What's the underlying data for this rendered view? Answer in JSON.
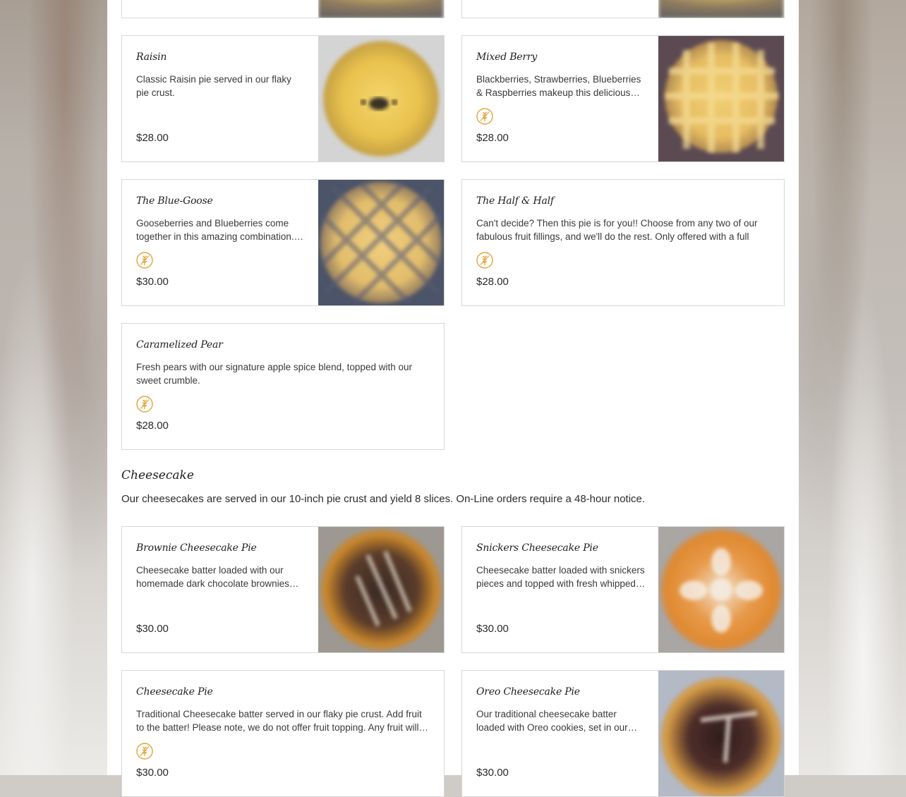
{
  "colors": {
    "badge_accent": "#e2a53a",
    "border": "#d7d7d7",
    "text": "#2a2a2a"
  },
  "top_partial_cards": [
    {
      "has_image": true
    },
    {
      "has_image": true
    }
  ],
  "fruit_items": [
    {
      "title": "Raisin",
      "description": "Classic Raisin pie served in our flaky pie crust.",
      "price": "$28.00",
      "badge": false,
      "has_image": true,
      "image": "raisin-pie-photo"
    },
    {
      "title": "Mixed Berry",
      "description": "Blackberries, Strawberries, Blueberries & Raspberries makeup this delicious…",
      "price": "$28.00",
      "badge": true,
      "badge_icon": "wheat-icon",
      "has_image": true,
      "image": "mixed-berry-pie-photo"
    },
    {
      "title": "The Blue-Goose",
      "description": "Gooseberries and Blueberries come together in this amazing combination.…",
      "price": "$30.00",
      "badge": true,
      "badge_icon": "wheat-icon",
      "has_image": true,
      "image": "blue-goose-pie-photo"
    },
    {
      "title": "The Half & Half",
      "description": "Can't decide? Then this pie is for you!! Choose from any two of our fabulous fruit fillings, and we'll do the rest. Only offered with a full cru…",
      "price": "$28.00",
      "badge": true,
      "badge_icon": "wheat-icon",
      "has_image": false
    },
    {
      "title": "Caramelized Pear",
      "description": "Fresh pears with our signature apple spice blend, topped with our sweet crumble.",
      "price": "$28.00",
      "badge": true,
      "badge_icon": "wheat-icon",
      "has_image": false
    }
  ],
  "cheesecake_section": {
    "title": "Cheesecake",
    "description": "Our cheesecakes are served in our 10-inch pie crust and yield 8 slices. On-Line orders require a 48-hour notice.",
    "items": [
      {
        "title": "Brownie Cheesecake Pie",
        "description": "Cheesecake batter loaded with our homemade dark chocolate brownies…",
        "price": "$30.00",
        "badge": false,
        "has_image": true,
        "image": "brownie-cheesecake-photo"
      },
      {
        "title": "Snickers Cheesecake Pie",
        "description": "Cheesecake batter loaded with snickers pieces and topped with fresh whipped…",
        "price": "$30.00",
        "badge": false,
        "has_image": true,
        "image": "snickers-cheesecake-photo"
      },
      {
        "title": "Cheesecake Pie",
        "description": "Traditional Cheesecake batter served in our flaky pie crust. Add fruit to the batter! Please note, we do not offer fruit topping. Any fruit will…",
        "price": "$30.00",
        "badge": true,
        "badge_icon": "wheat-icon",
        "has_image": false
      },
      {
        "title": "Oreo Cheesecake Pie",
        "description": "Our traditional cheesecake batter loaded with Oreo cookies, set in our…",
        "price": "$30.00",
        "badge": false,
        "has_image": true,
        "image": "oreo-cheesecake-photo"
      }
    ]
  }
}
